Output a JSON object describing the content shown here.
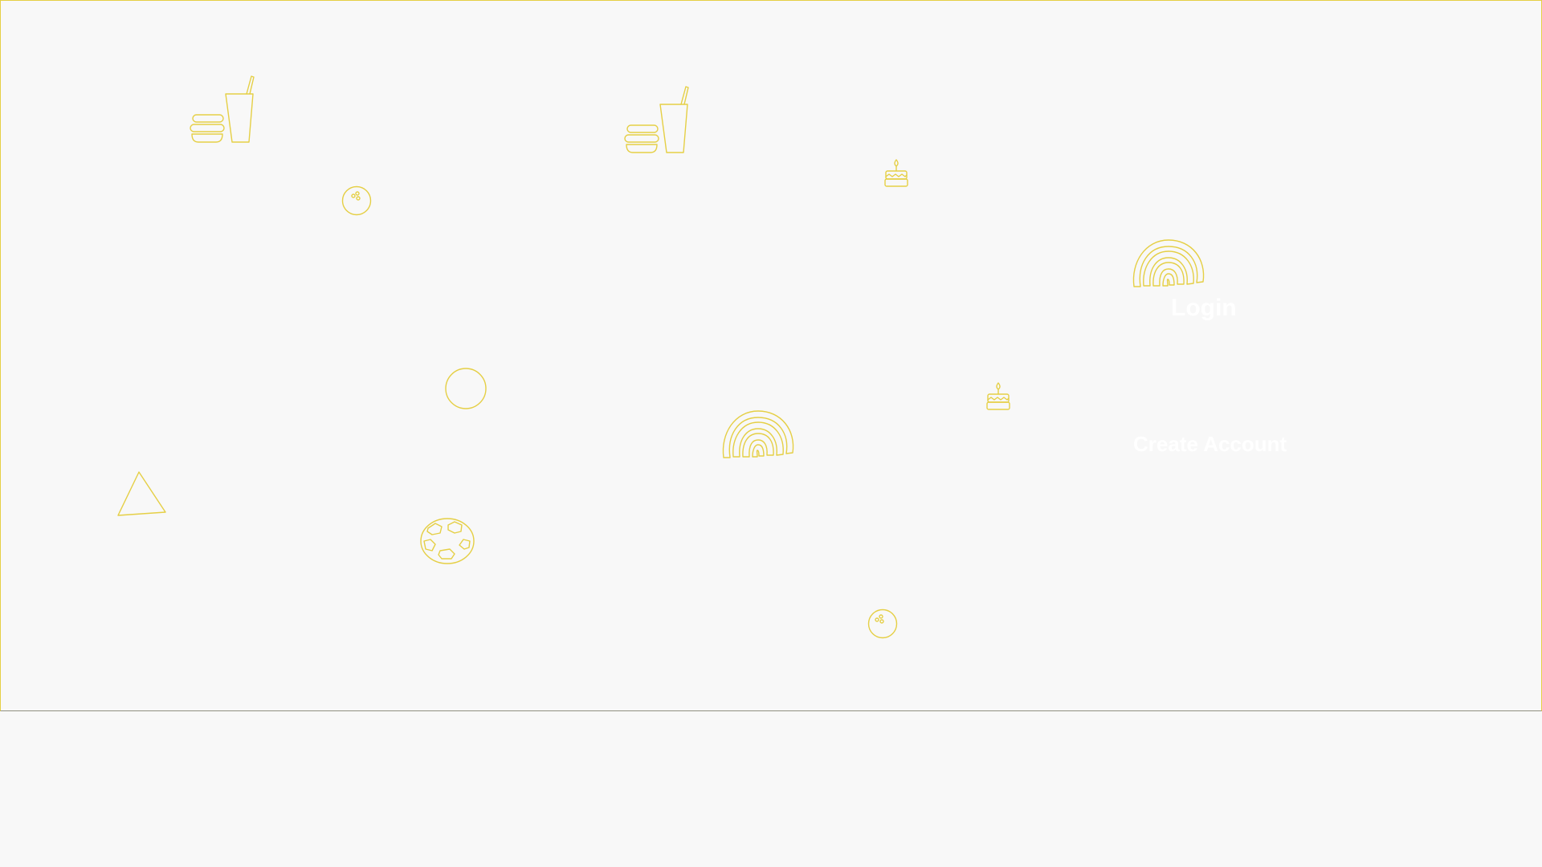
{
  "auth": {
    "login_label": "Login",
    "create_account_label": "Create Account"
  },
  "theme": {
    "accent": "#e5cf45",
    "background": "#f8f8f8",
    "link_text": "#ffffff"
  },
  "decorations": [
    "burger-drink-icon",
    "bowling-ball-icon",
    "birthday-cake-icon",
    "rainbow-icon",
    "circle-icon",
    "triangle-icon",
    "soccer-ball-icon"
  ]
}
